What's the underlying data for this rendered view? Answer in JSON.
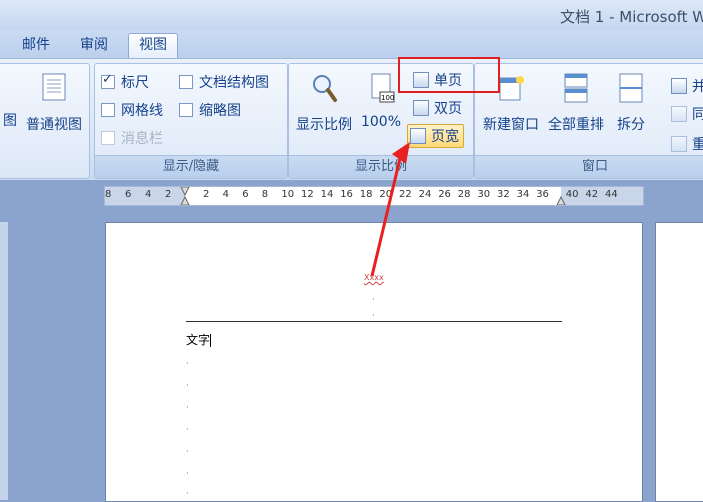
{
  "title": "文档 1 - Microsoft W",
  "tabs": [
    {
      "label": "邮件"
    },
    {
      "label": "审阅"
    },
    {
      "label": "视图",
      "active": true
    }
  ],
  "ribbon": {
    "views": {
      "partial_label": "图",
      "normal_view": "普通视图"
    },
    "show_hide": {
      "label": "显示/隐藏",
      "ruler": {
        "label": "标尺",
        "checked": true
      },
      "gridlines": {
        "label": "网格线",
        "checked": false
      },
      "message_bar": {
        "label": "消息栏",
        "checked": false,
        "disabled": true
      },
      "doc_map": {
        "label": "文档结构图",
        "checked": false
      },
      "thumbnails": {
        "label": "缩略图",
        "checked": false
      }
    },
    "zoom": {
      "label": "显示比例",
      "zoom_btn": "显示比例",
      "hundred": "100%",
      "one_page": "单页",
      "two_pages": "双页",
      "page_width": "页宽"
    },
    "window": {
      "label": "窗口",
      "new_window": "新建窗口",
      "arrange_all": "全部重排",
      "split": "拆分",
      "side_by_side": "并",
      "sync": "同",
      "reset": "重"
    }
  },
  "ruler_ticks": [
    "8",
    "6",
    "4",
    "2",
    "2",
    "4",
    "6",
    "8",
    "10",
    "12",
    "14",
    "16",
    "18",
    "20",
    "22",
    "24",
    "26",
    "28",
    "30",
    "32",
    "34",
    "36",
    "40",
    "42",
    "44"
  ],
  "document": {
    "header_text": "Xxxx",
    "body_text": "文字"
  },
  "colors": {
    "highlight": "#e02020",
    "accent": "#15428b"
  }
}
